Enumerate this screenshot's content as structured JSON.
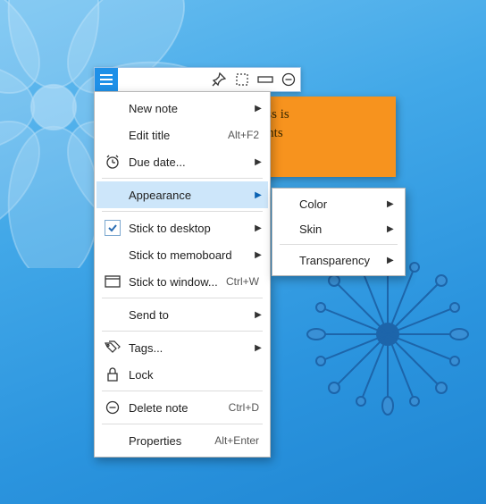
{
  "sticky_note": {
    "line1": "ppiness is",
    "line2": " thoughts"
  },
  "toolbar": {
    "icons": [
      "hamburger",
      "pin",
      "selection",
      "wide",
      "minimize"
    ]
  },
  "menu": {
    "items": [
      {
        "label": "New note",
        "icon": "",
        "shortcut": "",
        "submenu": true
      },
      {
        "label": "Edit title",
        "icon": "",
        "shortcut": "Alt+F2",
        "submenu": false
      },
      {
        "label": "Due date...",
        "icon": "clock",
        "shortcut": "",
        "submenu": true
      },
      {
        "label": "Appearance",
        "icon": "",
        "shortcut": "",
        "submenu": true,
        "highlight": true
      },
      {
        "label": "Stick to desktop",
        "icon": "check",
        "shortcut": "",
        "submenu": true
      },
      {
        "label": "Stick to memoboard",
        "icon": "",
        "shortcut": "",
        "submenu": true
      },
      {
        "label": "Stick to window...",
        "icon": "window",
        "shortcut": "Ctrl+W",
        "submenu": false
      },
      {
        "label": "Send to",
        "icon": "",
        "shortcut": "",
        "submenu": true
      },
      {
        "label": "Tags...",
        "icon": "tags",
        "shortcut": "",
        "submenu": true
      },
      {
        "label": "Lock",
        "icon": "lock",
        "shortcut": "",
        "submenu": false
      },
      {
        "label": "Delete note",
        "icon": "delete",
        "shortcut": "Ctrl+D",
        "submenu": false
      },
      {
        "label": "Properties",
        "icon": "",
        "shortcut": "Alt+Enter",
        "submenu": false
      }
    ],
    "separators_after": [
      2,
      3,
      6,
      7,
      9,
      10
    ]
  },
  "submenu": {
    "items": [
      {
        "label": "Color",
        "submenu": true
      },
      {
        "label": "Skin",
        "submenu": true
      },
      {
        "label": "Transparency",
        "submenu": true
      }
    ],
    "separators_after": [
      1
    ]
  },
  "colors": {
    "accent": "#1e90e8",
    "highlight": "#cde6fa",
    "note_bg": "#f7931e"
  }
}
